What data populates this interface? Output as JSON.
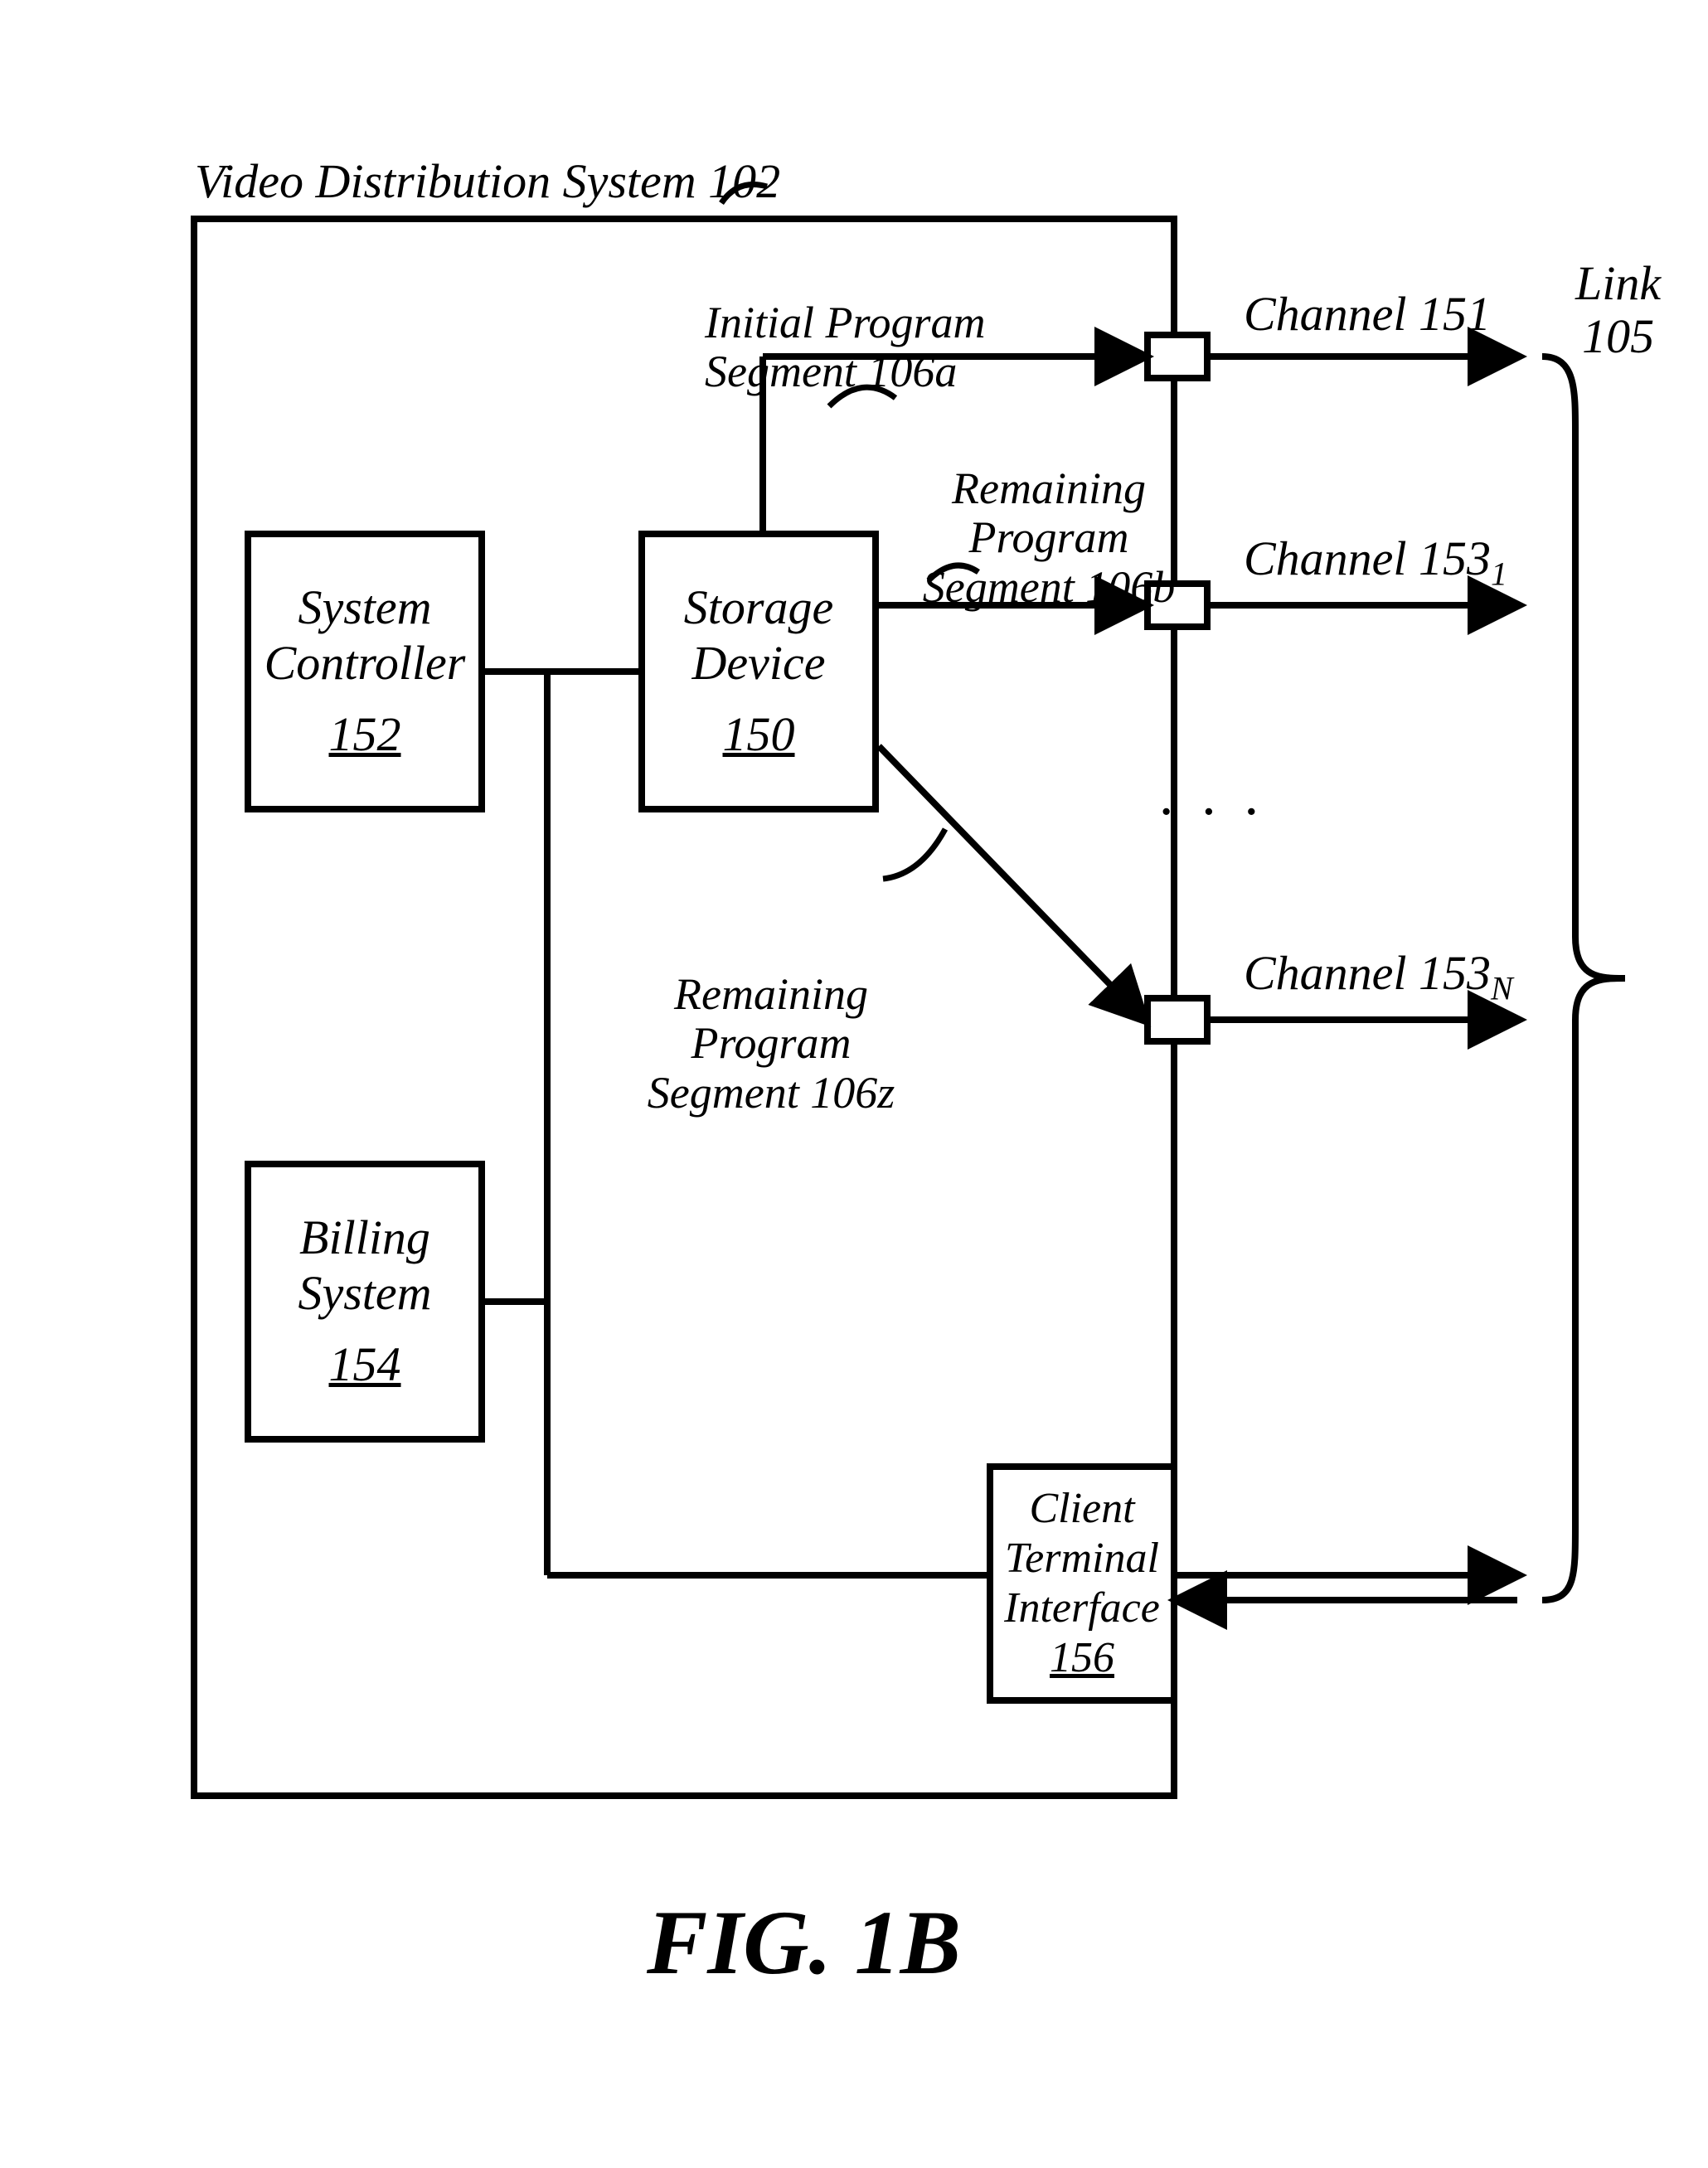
{
  "title_label": "Video Distribution System 102",
  "boxes": {
    "system_controller": {
      "l1": "System",
      "l2": "Controller",
      "num": "152"
    },
    "storage_device": {
      "l1": "Storage",
      "l2": "Device",
      "num": "150"
    },
    "billing_system": {
      "l1": "Billing",
      "l2": "System",
      "num": "154"
    },
    "client_terminal": {
      "l1": "Client",
      "l2": "Terminal",
      "l3": "Interface",
      "num": "156"
    }
  },
  "segments": {
    "initial": {
      "l1": "Initial Program",
      "l2": "Segment 106a"
    },
    "remain_b": {
      "l1": "Remaining Program",
      "l2": "Segment 106b"
    },
    "remain_z": {
      "l1": "Remaining Program",
      "l2": "Segment 106z"
    }
  },
  "channels": {
    "c151": {
      "text": "Channel 151"
    },
    "c153a": {
      "prefix": "Channel 153",
      "sub": "1"
    },
    "c153n": {
      "prefix": "Channel 153",
      "sub": "N"
    }
  },
  "link_label": {
    "l1": "Link",
    "l2": "105"
  },
  "figure_caption": "FIG. 1B"
}
